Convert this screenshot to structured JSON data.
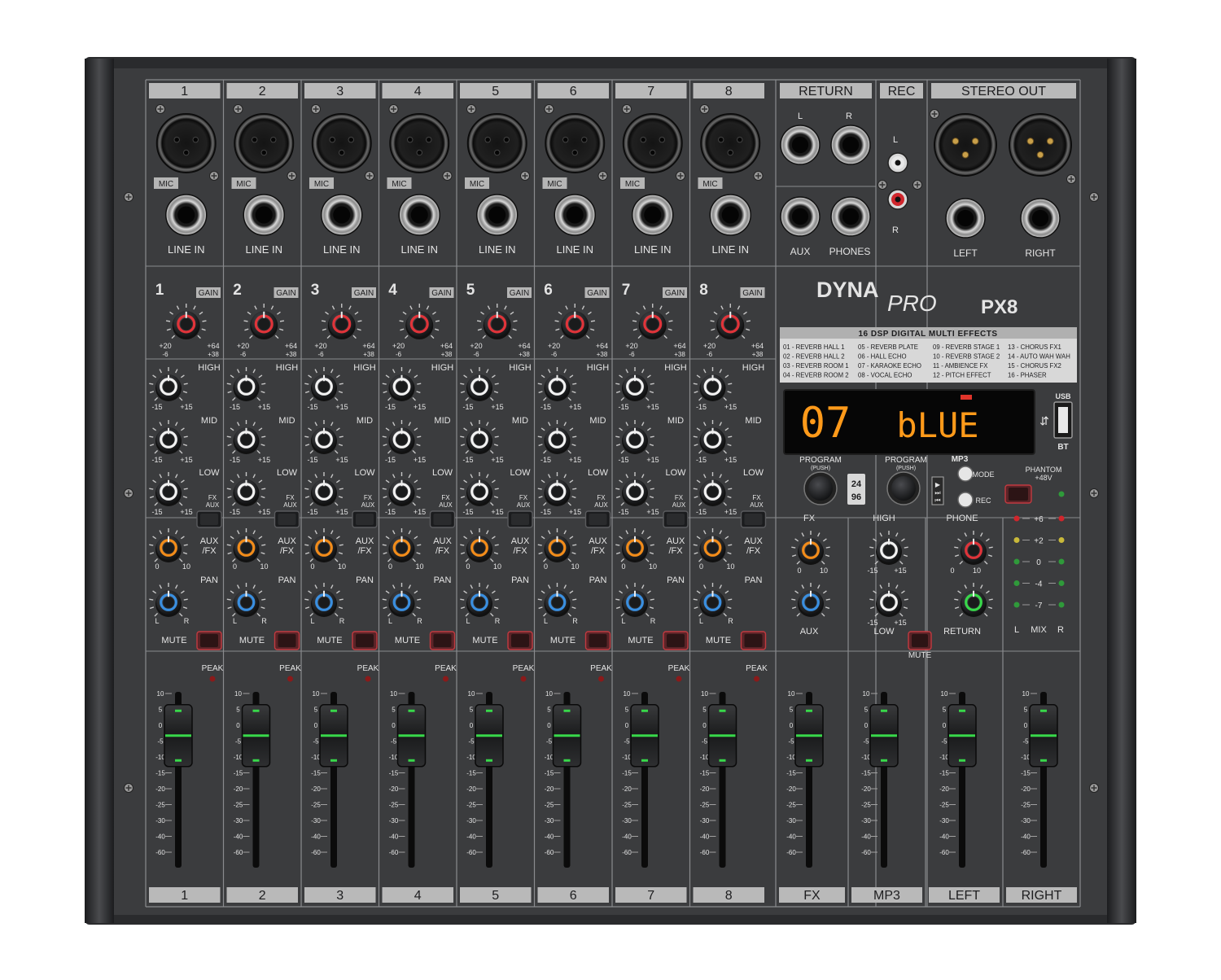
{
  "brand": {
    "name": "DYNA",
    "name_script": "PRO",
    "model": "PX8"
  },
  "top_labels": {
    "channels": [
      "1",
      "2",
      "3",
      "4",
      "5",
      "6",
      "7",
      "8"
    ],
    "return": "RETURN",
    "rec": "REC",
    "stereo_out": "STEREO OUT"
  },
  "bottom_labels": [
    "1",
    "2",
    "3",
    "4",
    "5",
    "6",
    "7",
    "8",
    "FX",
    "MP3",
    "LEFT",
    "RIGHT"
  ],
  "channel": {
    "mic_tag": "MIC",
    "line_in": "LINE IN",
    "gain": "GAIN",
    "gain_min": "+20",
    "gain_max": "+64",
    "gain_min_sub": "-6",
    "gain_max_sub": "+38",
    "high": "HIGH",
    "mid": "MID",
    "low": "LOW",
    "eq_min": "-15",
    "eq_max": "+15",
    "fx_switch": "FX",
    "aux_switch": "AUX",
    "auxfx_1": "AUX",
    "auxfx_2": "/FX",
    "send_min": "0",
    "send_max": "10",
    "pan": "PAN",
    "pan_l": "L",
    "pan_r": "R",
    "mute": "MUTE",
    "peak": "PEAK"
  },
  "return_section": {
    "l": "L",
    "r": "R",
    "aux": "AUX",
    "phones": "PHONES"
  },
  "rec_section": {
    "l": "L",
    "r": "R"
  },
  "out_section": {
    "left": "LEFT",
    "right": "RIGHT"
  },
  "effects": {
    "title": "16 DSP DIGITAL MULTI EFFECTS",
    "items": [
      "01 - REVERB HALL 1",
      "02 - REVERB HALL 2",
      "03 - REVERB ROOM 1",
      "04 - REVERB ROOM 2",
      "05 - REVERB PLATE",
      "06 - HALL ECHO",
      "07 - KARAOKE ECHO",
      "08 - VOCAL ECHO",
      "09 - REVERB STAGE 1",
      "10 - REVERB STAGE 2",
      "11 - AMBIENCE FX",
      "12 - PITCH EFFECT",
      "13 - CHORUS FX1",
      "14 - AUTO WAH WAH",
      "15 - CHORUS FX2",
      "16 - PHASER"
    ]
  },
  "display": {
    "number": "07",
    "text": "bLUE",
    "led_color": "#ff9a1a"
  },
  "usb": {
    "top": "USB",
    "bottom": "BT"
  },
  "controls": {
    "program_1": "PROGRAM",
    "program_2": "PROGRAM",
    "push": "(PUSH)",
    "rate_1": "24",
    "rate_2": "96",
    "mp3": "MP3",
    "mode": "MODE",
    "rec": "REC",
    "phantom": "PHANTOM",
    "phantom_v": "+48V"
  },
  "master": {
    "fx": "FX",
    "aux": "AUX",
    "high": "HIGH",
    "low": "LOW",
    "phone": "PHONE",
    "return": "RETURN",
    "mute": "MUTE",
    "eq_min": "-15",
    "eq_max": "+15",
    "send_min": "0",
    "send_max": "10"
  },
  "meter": {
    "levels": [
      "+6",
      "+2",
      "0",
      "-4",
      "-7"
    ],
    "l": "L",
    "mix": "MIX",
    "r": "R"
  },
  "fader_scale": [
    "10",
    "5",
    "0",
    "-5",
    "-10",
    "-15",
    "-20",
    "-25",
    "-30",
    "-40",
    "-60"
  ],
  "fader_positions": [
    0.28,
    0.28,
    0.28,
    0.28,
    0.28,
    0.28,
    0.28,
    0.28,
    0.28,
    0.28,
    0.28,
    0.28
  ],
  "colors": {
    "panel": "#3b3c3e",
    "casing": "#2a2b2d",
    "label_bar": "#b9b9b9",
    "gain_ring": "#e0343a",
    "eq_ring": "#f2f2f2",
    "aux_ring": "#f28c1a",
    "pan_ring": "#3a8fe0",
    "fader_led": "#38d84a"
  }
}
